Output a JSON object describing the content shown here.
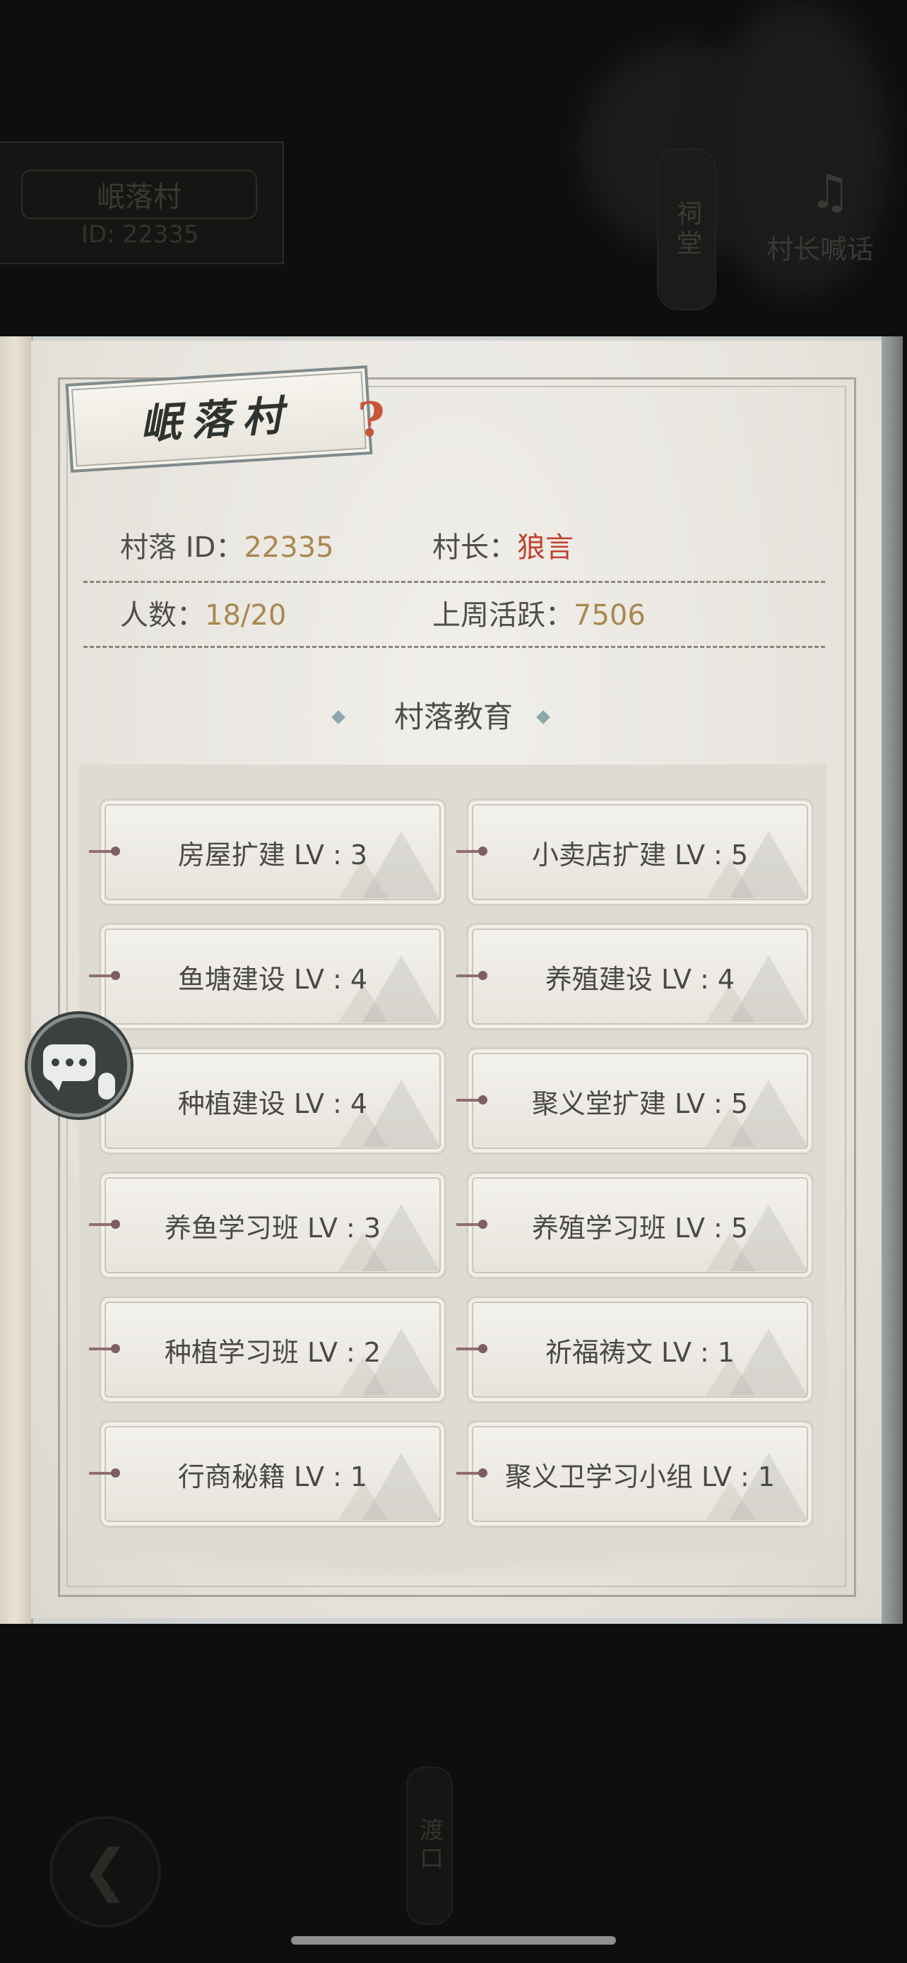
{
  "background": {
    "village_name": "岷落村",
    "village_id": "ID: 22335",
    "pillar_label": "祠堂",
    "shout_label": "村长喊话",
    "bottom_pillar_label": "渡口",
    "back_icon": "chevron-left-icon",
    "shout_icon": "horn-icon"
  },
  "panel": {
    "title": "岷落村",
    "help_icon": "question-icon",
    "help_symbol": "?",
    "info": {
      "village_id_label": "村落  ID：",
      "village_id_value": "22335",
      "leader_label": "村长：",
      "leader_value": "狼言",
      "population_label": "人数：",
      "population_value": "18/20",
      "activity_label": "上周活跃：",
      "activity_value": "7506"
    },
    "section_title": "村落教育",
    "education": [
      {
        "label": "房屋扩建 LV : 3"
      },
      {
        "label": "小卖店扩建 LV : 5"
      },
      {
        "label": "鱼塘建设 LV : 4"
      },
      {
        "label": "养殖建设 LV : 4"
      },
      {
        "label": "种植建设 LV : 4"
      },
      {
        "label": "聚义堂扩建 LV : 5"
      },
      {
        "label": "养鱼学习班 LV : 3"
      },
      {
        "label": "养殖学习班 LV : 5"
      },
      {
        "label": "种植学习班 LV : 2"
      },
      {
        "label": "祈福祷文 LV : 1"
      },
      {
        "label": "行商秘籍 LV : 1"
      },
      {
        "label": "聚义卫学习小组 LV : 1"
      }
    ]
  },
  "chat_icon": "chat-bubble-icon",
  "colors": {
    "accent_gold": "#a8894f",
    "leader_red": "#c2402f",
    "help_orange": "#c9553a",
    "backdrop": "#0d0e0d"
  }
}
